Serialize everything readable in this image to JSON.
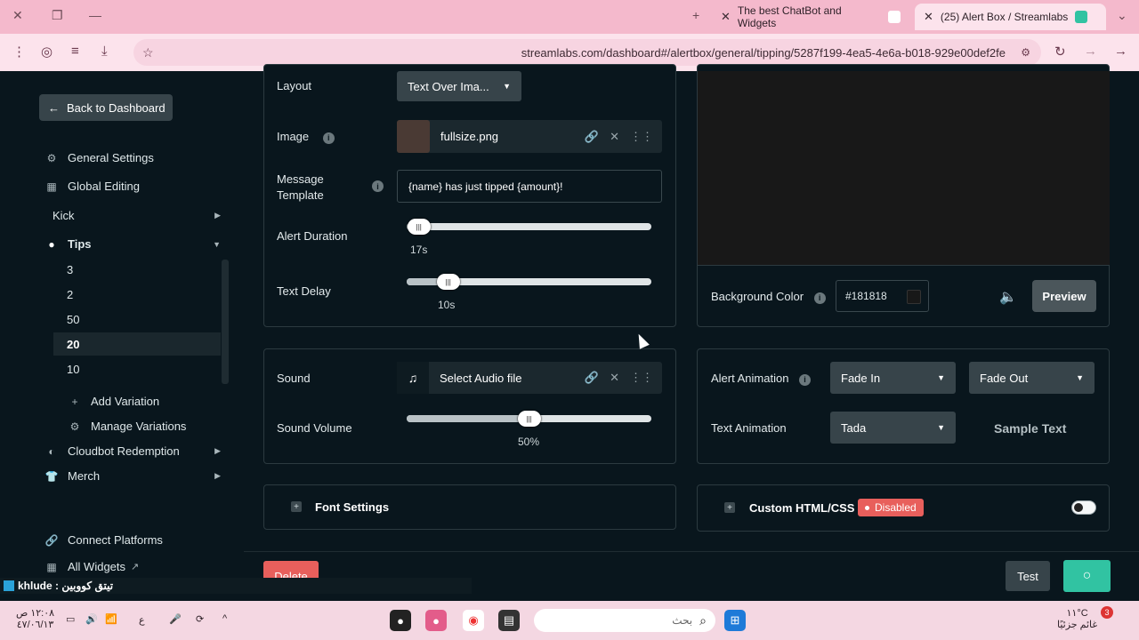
{
  "browser": {
    "tabs": [
      {
        "title": "The best ChatBot and Widgets"
      },
      {
        "title": "(25) Alert Box / Streamlabs"
      }
    ],
    "url": "streamlabs.com/dashboard#/alertbox/general/tipping/5287f199-4ea5-4e6a-b018-929e00def2fe"
  },
  "sidebar": {
    "back_label": "Back to Dashboard",
    "items": [
      {
        "label": "General Settings",
        "icon": "gear-icon"
      },
      {
        "label": "Global Editing",
        "icon": "grid-icon"
      },
      {
        "label": "Kick",
        "icon": ""
      },
      {
        "label": "Tips",
        "icon": "tips-icon"
      }
    ],
    "tips_sub": [
      "3",
      "2",
      "50",
      "20",
      "10"
    ],
    "active_sub": "20",
    "add_variation": "Add Variation",
    "manage_variations": "Manage Variations",
    "cloudbot": "Cloudbot Redemption",
    "merch": "Merch",
    "connect_platforms": "Connect Platforms",
    "all_widgets": "All Widgets"
  },
  "settings": {
    "layout_label": "Layout",
    "layout_value": "Text Over Ima...",
    "image_label": "Image",
    "image_file": "fullsize.png",
    "message_template_label_1": "Message",
    "message_template_label_2": "Template",
    "message_template_value": "{name} has just tipped {amount}!",
    "alert_duration_label": "Alert Duration",
    "alert_duration_value": "17s",
    "alert_duration_fraction": 0.05,
    "text_delay_label": "Text Delay",
    "text_delay_value": "10s",
    "text_delay_fraction": 0.17,
    "background_color_label": "Background Color",
    "background_color_value": "#181818",
    "preview_label": "Preview"
  },
  "sound": {
    "sound_label": "Sound",
    "audio_file": "Select Audio file",
    "volume_label": "Sound Volume",
    "volume_value": "50%",
    "volume_fraction": 0.5
  },
  "animation": {
    "alert_animation_label": "Alert Animation",
    "alert_in": "Fade In",
    "alert_out": "Fade Out",
    "text_animation_label": "Text Animation",
    "text_animation_value": "Tada",
    "sample_text": "Sample Text"
  },
  "sections": {
    "font_settings": "Font Settings",
    "custom_html": "Custom HTML/CSS",
    "custom_status": "Disabled"
  },
  "footer": {
    "delete_label": "Delete",
    "test_label": "Test"
  },
  "ticker": {
    "text": "khlude : تيتق كووبين"
  },
  "taskbar": {
    "time": "١٢:٠٨ ص",
    "date": "٤٧/٠٦/١٣",
    "search_placeholder": "بحث",
    "lang": "ع",
    "temperature": "١١°C",
    "weather_text": "غائم جزئيًا",
    "notif_count": "3"
  },
  "colors": {
    "accent": "#31c3a2",
    "danger": "#e85f5c",
    "bg": "#09161d",
    "tab_bar": "#f4b9cc"
  }
}
